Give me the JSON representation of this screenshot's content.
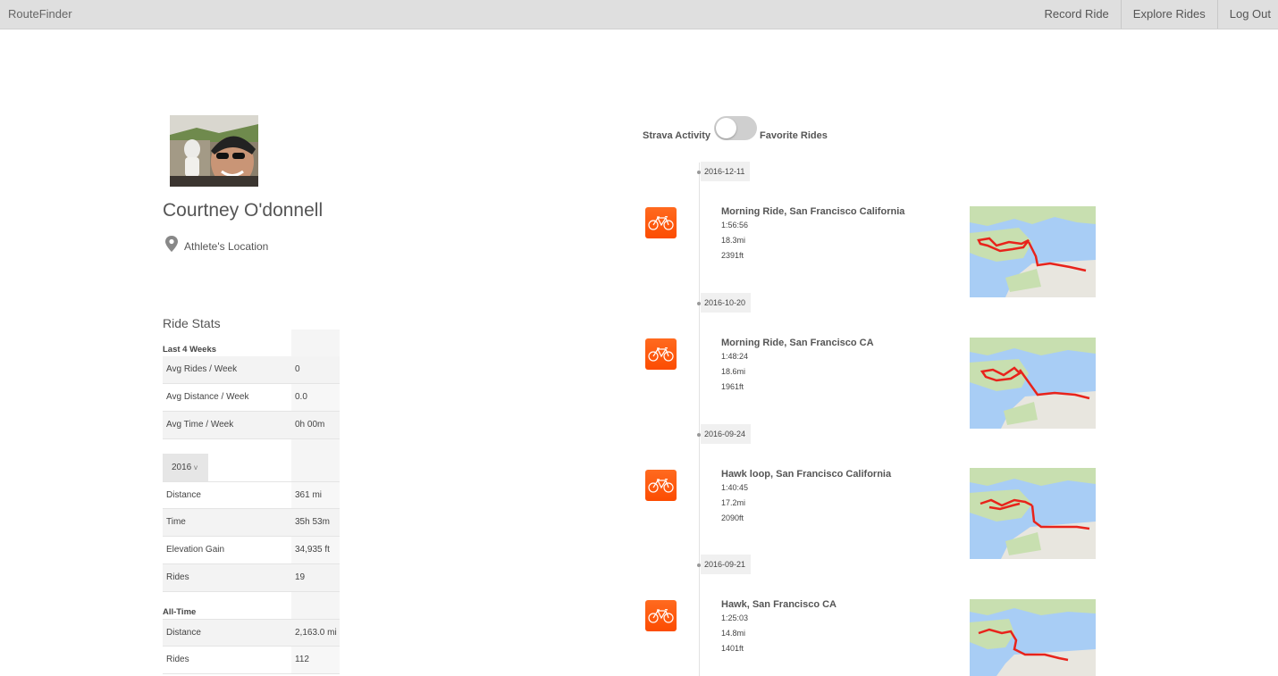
{
  "nav": {
    "brand": "RouteFinder",
    "links": [
      "Record Ride",
      "Explore Rides",
      "Log Out"
    ]
  },
  "profile": {
    "name": "Courtney O'donnell",
    "location": "Athlete's Location"
  },
  "stats": {
    "title": "Ride Stats",
    "last4": {
      "heading": "Last 4 Weeks",
      "rows": [
        {
          "k": "Avg Rides / Week",
          "v": "0"
        },
        {
          "k": "Avg Distance / Week",
          "v": "0.0"
        },
        {
          "k": "Avg Time / Week",
          "v": "0h 00m"
        }
      ]
    },
    "year": {
      "selected": "2016",
      "caret": "v",
      "rows": [
        {
          "k": "Distance",
          "v": "361 mi"
        },
        {
          "k": "Time",
          "v": "35h 53m"
        },
        {
          "k": "Elevation Gain",
          "v": "34,935 ft"
        },
        {
          "k": "Rides",
          "v": "19"
        }
      ]
    },
    "alltime": {
      "heading": "All-Time",
      "rows": [
        {
          "k": "Distance",
          "v": "2,163.0 mi"
        },
        {
          "k": "Rides",
          "v": "112"
        }
      ]
    }
  },
  "toggle": {
    "left_label": "Strava Activity",
    "right_label": "Favorite Rides"
  },
  "rides": [
    {
      "date": "2016-12-11",
      "title": "Morning Ride, San Francisco California",
      "time": "1:56:56",
      "distance": "18.3mi",
      "elevation": "2391ft"
    },
    {
      "date": "2016-10-20",
      "title": "Morning Ride, San Francisco CA",
      "time": "1:48:24",
      "distance": "18.6mi",
      "elevation": "1961ft"
    },
    {
      "date": "2016-09-24",
      "title": "Hawk loop, San Francisco California",
      "time": "1:40:45",
      "distance": "17.2mi",
      "elevation": "2090ft"
    },
    {
      "date": "2016-09-21",
      "title": "Hawk, San Francisco CA",
      "time": "1:25:03",
      "distance": "14.8mi",
      "elevation": "1401ft"
    }
  ],
  "colors": {
    "navbar": "#dfdfdf",
    "strava_orange": "#fc4c02",
    "route_red": "#e8231b",
    "water": "#a8cdf5",
    "land": "#e8e6df",
    "park": "#c8dfb0"
  }
}
